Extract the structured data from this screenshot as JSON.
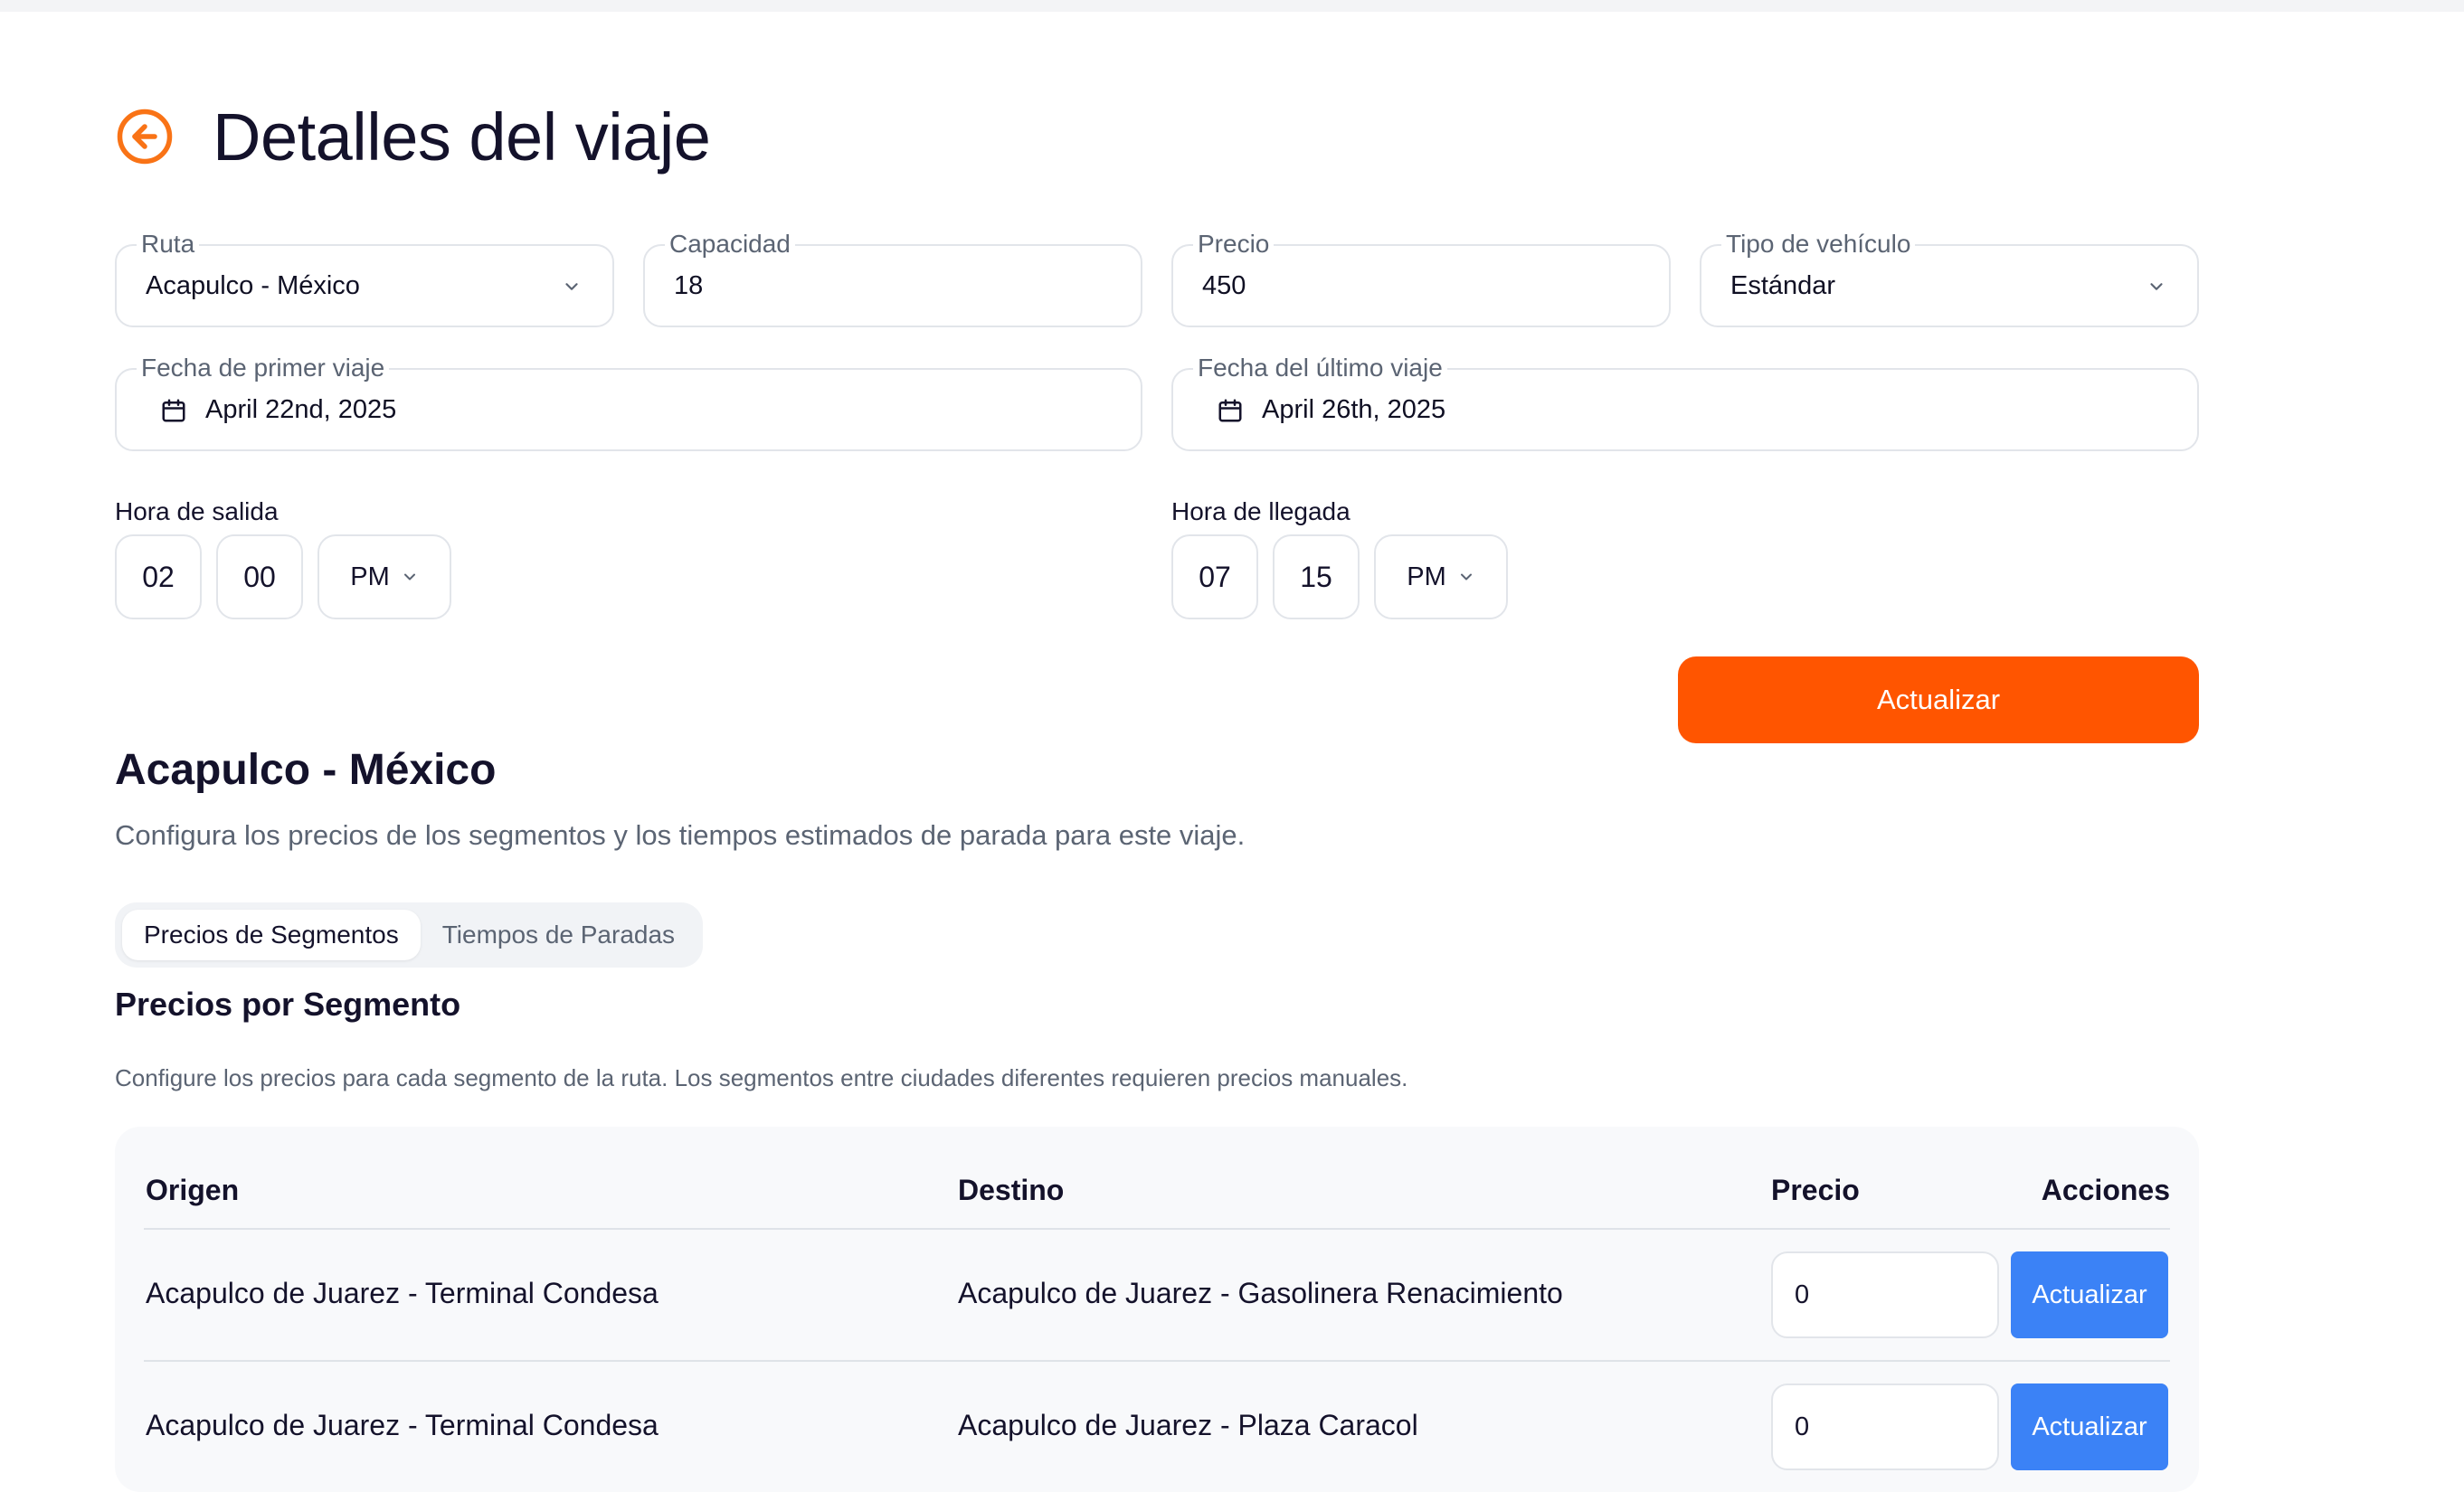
{
  "page": {
    "title": "Detalles del viaje"
  },
  "form": {
    "route": {
      "label": "Ruta",
      "value": "Acapulco - México"
    },
    "capacity": {
      "label": "Capacidad",
      "value": "18"
    },
    "price": {
      "label": "Precio",
      "value": "450"
    },
    "vehicle_type": {
      "label": "Tipo de vehículo",
      "value": "Estándar"
    },
    "first_trip_date": {
      "label": "Fecha de primer viaje",
      "value": "April 22nd, 2025"
    },
    "last_trip_date": {
      "label": "Fecha del último viaje",
      "value": "April 26th, 2025"
    },
    "departure": {
      "label": "Hora de salida",
      "hour": "02",
      "minute": "00",
      "period": "PM"
    },
    "arrival": {
      "label": "Hora de llegada",
      "hour": "07",
      "minute": "15",
      "period": "PM"
    },
    "update_label": "Actualizar"
  },
  "route_section": {
    "title": "Acapulco - México",
    "description": "Configura los precios de los segmentos y los tiempos estimados de parada para este viaje.",
    "tabs": [
      {
        "label": "Precios de Segmentos",
        "active": true
      },
      {
        "label": "Tiempos de Paradas",
        "active": false
      }
    ]
  },
  "segments": {
    "title": "Precios por Segmento",
    "description": "Configure los precios para cada segmento de la ruta. Los segmentos entre ciudades diferentes requieren precios manuales.",
    "columns": [
      "Origen",
      "Destino",
      "Precio",
      "Acciones"
    ],
    "rows": [
      {
        "origin": "Acapulco de Juarez - Terminal Condesa",
        "destination": "Acapulco de Juarez - Gasolinera Renacimiento",
        "price": "0",
        "action": "Actualizar"
      },
      {
        "origin": "Acapulco de Juarez - Terminal Condesa",
        "destination": "Acapulco de Juarez - Plaza Caracol",
        "price": "0",
        "action": "Actualizar"
      }
    ]
  },
  "colors": {
    "accent": "#ff5500",
    "back_icon": "#f97316",
    "row_button": "#3b82f6"
  },
  "icons": [
    "arrow-left-circle-icon",
    "chevron-down-icon",
    "calendar-icon"
  ]
}
